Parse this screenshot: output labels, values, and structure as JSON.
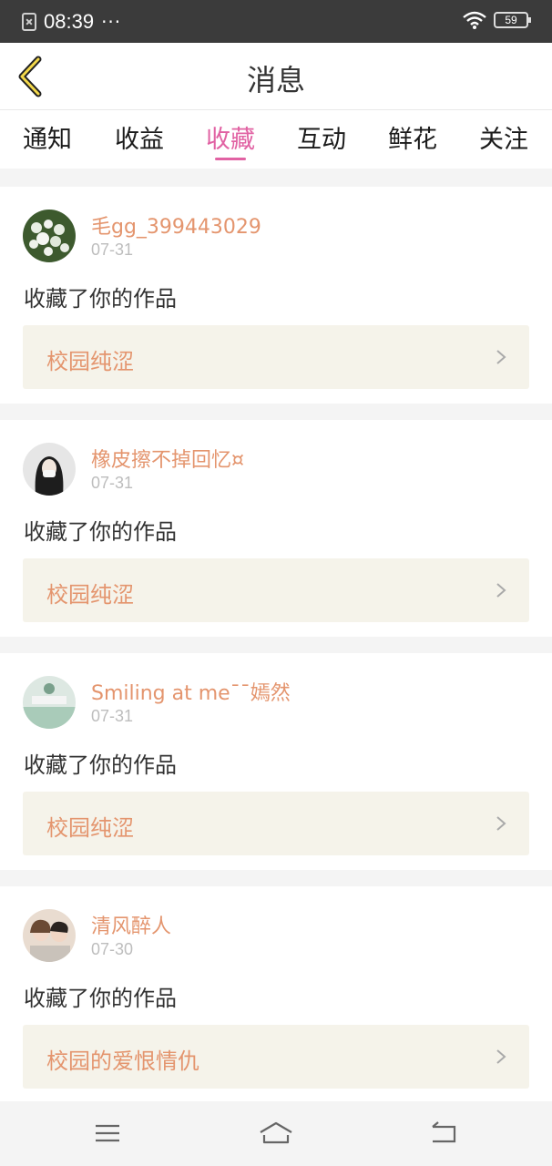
{
  "status_bar": {
    "time": "08:39",
    "dots": "···",
    "battery": "59"
  },
  "header": {
    "title": "消息"
  },
  "tabs": [
    {
      "label": "通知"
    },
    {
      "label": "收益"
    },
    {
      "label": "收藏",
      "active": true
    },
    {
      "label": "互动"
    },
    {
      "label": "鲜花"
    },
    {
      "label": "关注"
    }
  ],
  "messages": [
    {
      "name": "毛gg_399443029",
      "date": "07-31",
      "action": "收藏了你的作品",
      "work": "校园纯涩"
    },
    {
      "name": "橡皮擦不掉回忆¤",
      "date": "07-31",
      "action": "收藏了你的作品",
      "work": "校园纯涩"
    },
    {
      "name": "Smiling at me¯¯嫣然",
      "date": "07-31",
      "action": "收藏了你的作品",
      "work": "校园纯涩"
    },
    {
      "name": "清风醉人",
      "date": "07-30",
      "action": "收藏了你的作品",
      "work": "校园的爱恨情仇"
    }
  ],
  "colors": {
    "accent": "#e162a3",
    "name": "#e4956e",
    "work_bg": "#f5f3ea"
  },
  "icons": {
    "back": "back-arrow-icon",
    "chevron": "chevron-right-icon",
    "menu": "menu-icon",
    "home": "home-icon",
    "return": "return-icon"
  }
}
